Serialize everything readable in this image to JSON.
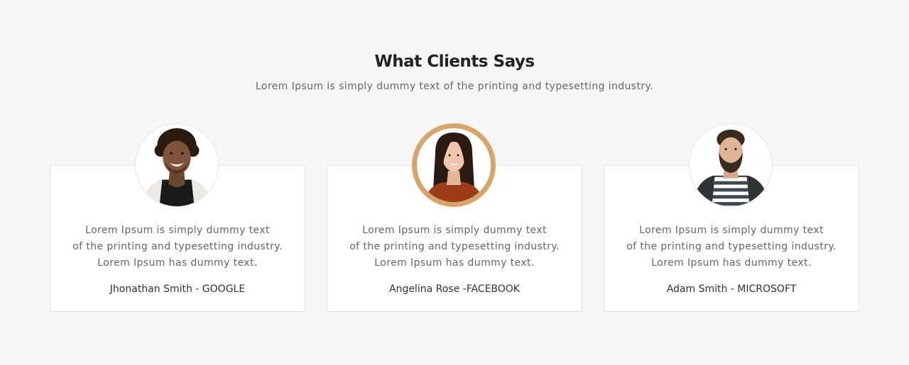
{
  "section": {
    "title": "What Clients Says",
    "subtitle": "Lorem Ipsum is simply dummy text of the printing and typesetting industry."
  },
  "testimonials": [
    {
      "line1": "Lorem Ipsum is simply dummy text",
      "line2": "of the printing and typesetting industry.",
      "line3": "Lorem Ipsum has dummy text.",
      "author": "Jhonathan Smith - GOOGLE",
      "avatar_icon": "man-smiling-photo"
    },
    {
      "line1": "Lorem Ipsum is simply dummy text",
      "line2": "of the printing and typesetting industry.",
      "line3": "Lorem Ipsum has dummy text.",
      "author": "Angelina Rose -FACEBOOK",
      "avatar_icon": "woman-smiling-photo"
    },
    {
      "line1": "Lorem Ipsum is simply dummy text",
      "line2": "of the printing and typesetting industry.",
      "line3": "Lorem Ipsum has dummy text.",
      "author": "Adam Smith - MICROSOFT",
      "avatar_icon": "bearded-man-photo"
    }
  ],
  "colors": {
    "background": "#f6f6f6",
    "card": "#ffffff",
    "active_ring": "#d9a46a",
    "title": "#222222",
    "text": "#666666"
  }
}
